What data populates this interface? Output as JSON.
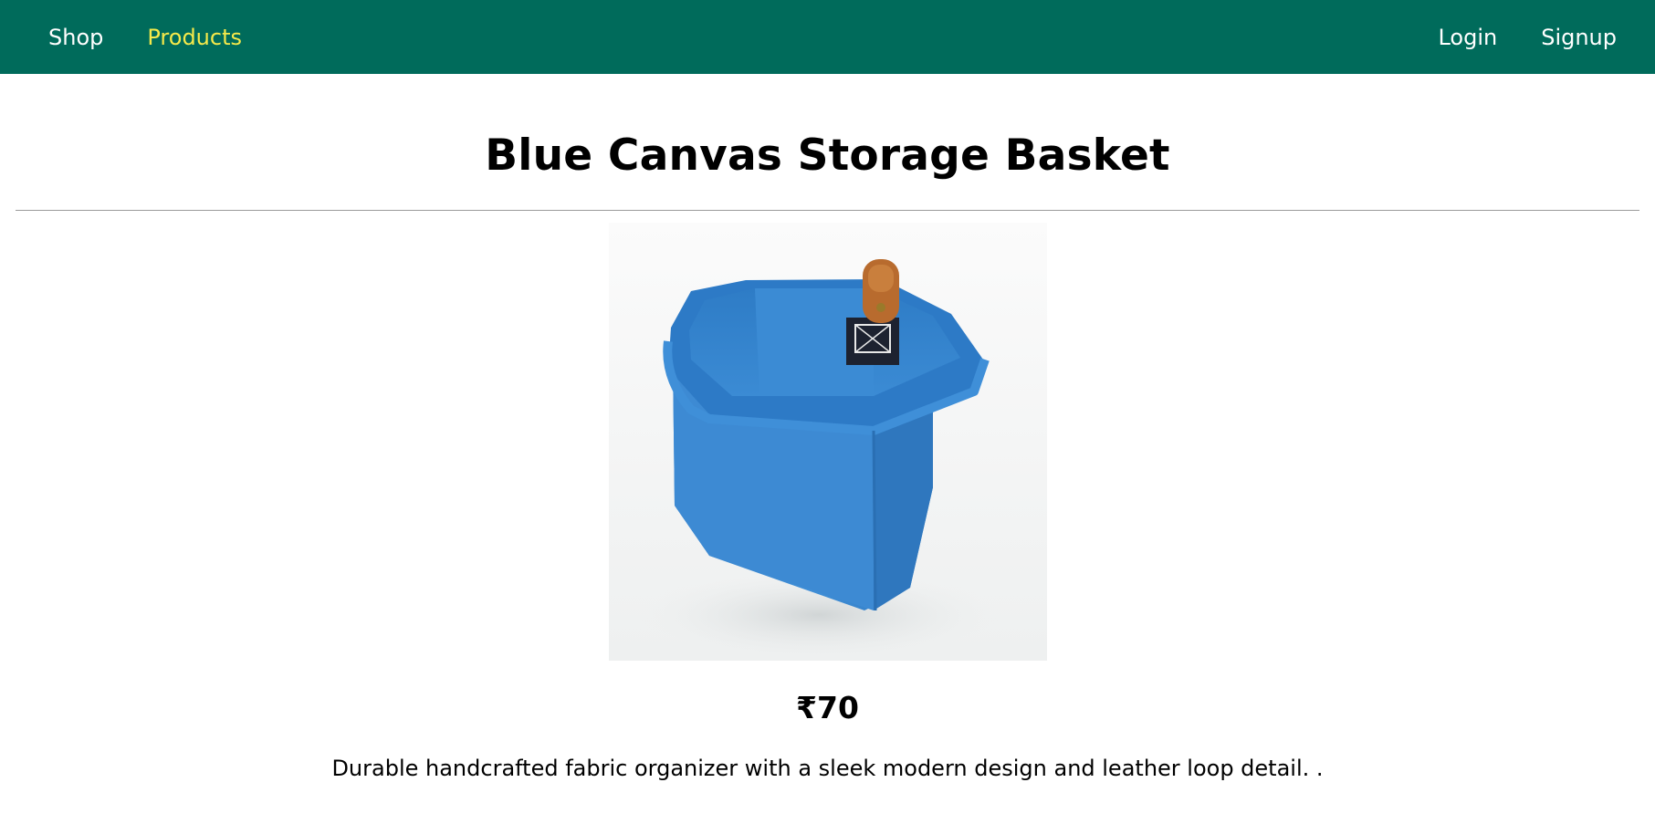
{
  "nav": {
    "left": [
      {
        "label": "Shop",
        "active": false
      },
      {
        "label": "Products",
        "active": true
      }
    ],
    "right": [
      {
        "label": "Login"
      },
      {
        "label": "Signup"
      }
    ],
    "bg_color": "#006b5b",
    "active_color": "#f5e94a"
  },
  "product": {
    "title": "Blue Canvas Storage Basket",
    "image_icon": "product-photo",
    "price": "₹70",
    "description": "Durable handcrafted fabric organizer with a sleek modern design and leather loop detail. ."
  }
}
